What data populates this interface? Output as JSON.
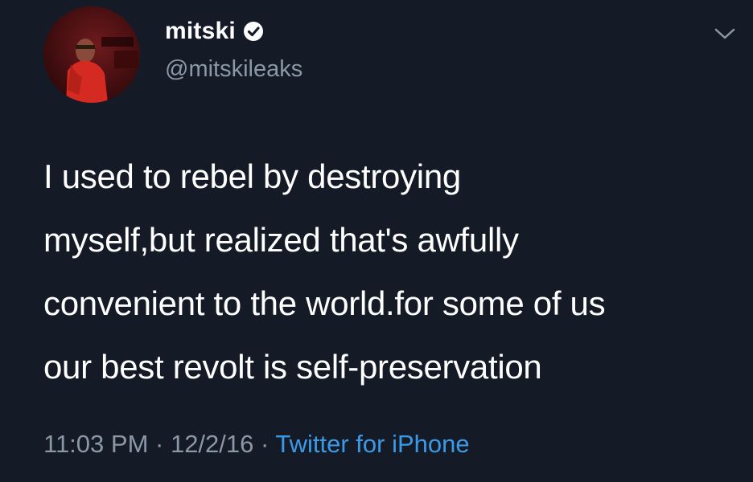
{
  "user": {
    "display_name": "mitski",
    "handle": "@mitskileaks",
    "verified": true,
    "avatar_icon": "profile-photo"
  },
  "menu": {
    "icon": "chevron-down-icon"
  },
  "tweet": {
    "line1": "I used to rebel by destroying",
    "line2": "myself,but realized that's awfully",
    "line3": "convenient to the world.for some of us",
    "line4": "our best revolt is self-preservation"
  },
  "meta": {
    "time": "11:03 PM",
    "separator1": " · ",
    "date": "12/2/16",
    "separator2": " · ",
    "source": "Twitter for iPhone"
  },
  "colors": {
    "background": "#151b26",
    "text": "#ffffff",
    "secondary": "#8b98a5",
    "link": "#3b9ae8"
  }
}
